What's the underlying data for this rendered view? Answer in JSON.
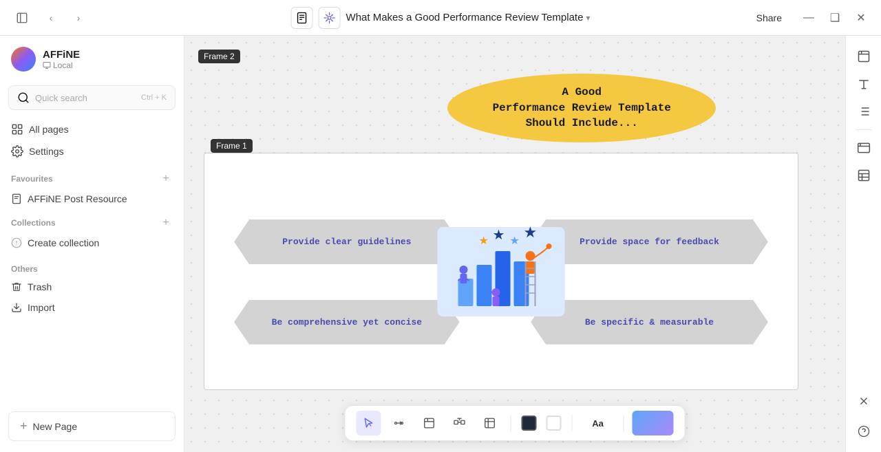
{
  "topbar": {
    "doc_icon_label": "doc",
    "edgeless_icon_label": "edgeless",
    "title": "What Makes a Good Performance Review Template",
    "chevron": "▾",
    "share_label": "Share",
    "nav_back": "‹",
    "nav_forward": "›",
    "win_minimize": "—",
    "win_maximize": "❑",
    "win_close": "✕"
  },
  "sidebar": {
    "user_name": "AFFiNE",
    "workspace": "Local",
    "search_placeholder": "Quick search",
    "search_shortcut": "Ctrl + K",
    "nav_items": [
      {
        "id": "all-pages",
        "label": "All pages",
        "icon": "pages"
      },
      {
        "id": "settings",
        "label": "Settings",
        "icon": "settings"
      }
    ],
    "favourites_label": "Favourites",
    "favourites_items": [
      {
        "label": "AFFiNE Post Resource"
      }
    ],
    "collections_label": "Collections",
    "collections_items": [
      {
        "label": "Create collection"
      }
    ],
    "others_label": "Others",
    "others_items": [
      {
        "id": "trash",
        "label": "Trash",
        "icon": "trash"
      },
      {
        "id": "import",
        "label": "Import",
        "icon": "import"
      }
    ],
    "new_page_label": "New Page"
  },
  "canvas": {
    "frame2_label": "Frame 2",
    "frame1_label": "Frame 1",
    "oval_text_line1": "A Good",
    "oval_text_line2": "Performance Review Template",
    "oval_text_line3": "Should Include...",
    "diamond_items": [
      {
        "id": "top-left",
        "text": "Provide clear guidelines"
      },
      {
        "id": "top-right",
        "text": "Provide space for feedback"
      },
      {
        "id": "bottom-left",
        "text": "Be comprehensive yet concise"
      },
      {
        "id": "bottom-right",
        "text": "Be specific & measurable"
      }
    ]
  },
  "right_toolbar": {
    "buttons": [
      {
        "id": "frame-btn",
        "icon": "frame"
      },
      {
        "id": "text-btn",
        "icon": "text"
      },
      {
        "id": "list-btn",
        "icon": "list"
      },
      {
        "id": "code-btn",
        "icon": "code"
      },
      {
        "id": "layout-btn",
        "icon": "layout"
      }
    ]
  },
  "bottom_toolbar": {
    "tools": [
      {
        "id": "select",
        "label": "Select",
        "active": true
      },
      {
        "id": "connect",
        "label": "Connect"
      },
      {
        "id": "frame",
        "label": "Frame"
      },
      {
        "id": "group",
        "label": "Group"
      },
      {
        "id": "note",
        "label": "Note"
      }
    ],
    "color_tools": [
      {
        "id": "dark-color",
        "color": "#1e293b"
      },
      {
        "id": "white-color",
        "color": "#ffffff"
      }
    ],
    "font_label": "Aa",
    "style_label": "Style"
  }
}
